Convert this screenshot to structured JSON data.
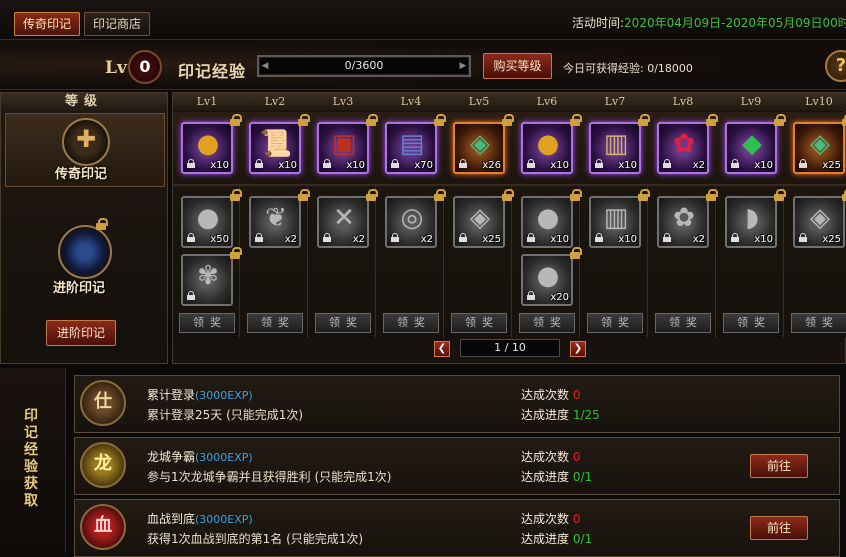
{
  "tabs": [
    "传奇印记",
    "印记商店"
  ],
  "activity": {
    "label": "活动时间:",
    "value": "2020年04月09日-2020年05月09日00时00分"
  },
  "level": {
    "prefix": "Lv",
    "value": "0",
    "title": "印记经验"
  },
  "exp_bar": {
    "text": "0/3600",
    "current": 0,
    "max": 3600
  },
  "buy_level_label": "购买等级",
  "today_exp": "今日可获得经验: 0/18000",
  "help_icon": "?",
  "left_panel": {
    "header": "等级",
    "legend_label": "传奇印记",
    "advanced_label": "进阶印记",
    "advanced_button": "进阶印记"
  },
  "levels": [
    "Lv1",
    "Lv2",
    "Lv3",
    "Lv4",
    "Lv5",
    "Lv6",
    "Lv7",
    "Lv8",
    "Lv9",
    "Lv10"
  ],
  "legend_rewards": [
    {
      "icon": "gold-coin-icon",
      "glyph": "●",
      "count": "x10",
      "color": "#e0a020",
      "quality": "leg"
    },
    {
      "icon": "scroll-icon",
      "glyph": "📜",
      "count": "x10",
      "color": "#70a0e0",
      "quality": "leg"
    },
    {
      "icon": "red-book-icon",
      "glyph": "▣",
      "count": "x10",
      "color": "#c03020",
      "quality": "leg"
    },
    {
      "icon": "blue-tome-icon",
      "glyph": "▤",
      "count": "x70",
      "color": "#6080d0",
      "quality": "leg"
    },
    {
      "icon": "jade-pouch-icon",
      "glyph": "◈",
      "count": "x26",
      "color": "#40c080",
      "quality": "legor"
    },
    {
      "icon": "gold-coin-icon",
      "glyph": "●",
      "count": "x10",
      "color": "#e0a020",
      "quality": "leg"
    },
    {
      "icon": "book-icon",
      "glyph": "▥",
      "count": "x10",
      "color": "#d0b070",
      "quality": "leg"
    },
    {
      "icon": "rose-icon",
      "glyph": "✿",
      "count": "x2",
      "color": "#e02040",
      "quality": "leg"
    },
    {
      "icon": "jade-leaf-icon",
      "glyph": "◆",
      "count": "x10",
      "color": "#30c050",
      "quality": "leg"
    },
    {
      "icon": "jade-pouch-icon",
      "glyph": "◈",
      "count": "x25",
      "color": "#40c080",
      "quality": "legor"
    }
  ],
  "advanced_rewards": [
    {
      "icon": "silver-coin-icon",
      "glyph": "●",
      "count": "x50"
    },
    {
      "icon": "feather-icon",
      "glyph": "❦",
      "count": "x2"
    },
    {
      "icon": "crossbow-icon",
      "glyph": "✕",
      "count": "x2"
    },
    {
      "icon": "ring-icon",
      "glyph": "◎",
      "count": "x2"
    },
    {
      "icon": "armor-icon",
      "glyph": "◈",
      "count": "x25"
    },
    {
      "icon": "silver-coin-icon",
      "glyph": "●",
      "count": "x10"
    },
    {
      "icon": "book-icon",
      "glyph": "▥",
      "count": "x10"
    },
    {
      "icon": "rose-icon",
      "glyph": "✿",
      "count": "x2"
    },
    {
      "icon": "helmet-icon",
      "glyph": "◗",
      "count": "x10"
    },
    {
      "icon": "armor-icon",
      "glyph": "◈",
      "count": "x25"
    }
  ],
  "advanced_extra": [
    {
      "icon": "flower-icon",
      "glyph": "✾",
      "count": ""
    },
    {
      "icon": "silver-coin-icon",
      "glyph": "●",
      "count": "x20"
    }
  ],
  "claim_label": "领奖",
  "pagination": {
    "text": "1 / 10",
    "current": 1,
    "total": 10
  },
  "exp_section_title": "印记经验获取",
  "tasks": [
    {
      "icon_char": "仕",
      "name": "累计登录",
      "exp": "(3000EXP)",
      "desc": "累计登录25天 (只能完成1次)",
      "times_label": "达成次数",
      "times": "0",
      "progress_label": "达成进度",
      "progress": "1/25",
      "button": ""
    },
    {
      "icon_char": "龙",
      "name": "龙城争霸",
      "exp": "(3000EXP)",
      "desc": "参与1次龙城争霸并且获得胜利 (只能完成1次)",
      "times_label": "达成次数",
      "times": "0",
      "progress_label": "达成进度",
      "progress": "0/1",
      "button": "前往"
    },
    {
      "icon_char": "血",
      "name": "血战到底",
      "exp": "(3000EXP)",
      "desc": "获得1次血战到底的第1名 (只能完成1次)",
      "times_label": "达成次数",
      "times": "0",
      "progress_label": "达成进度",
      "progress": "0/1",
      "button": "前往"
    }
  ]
}
